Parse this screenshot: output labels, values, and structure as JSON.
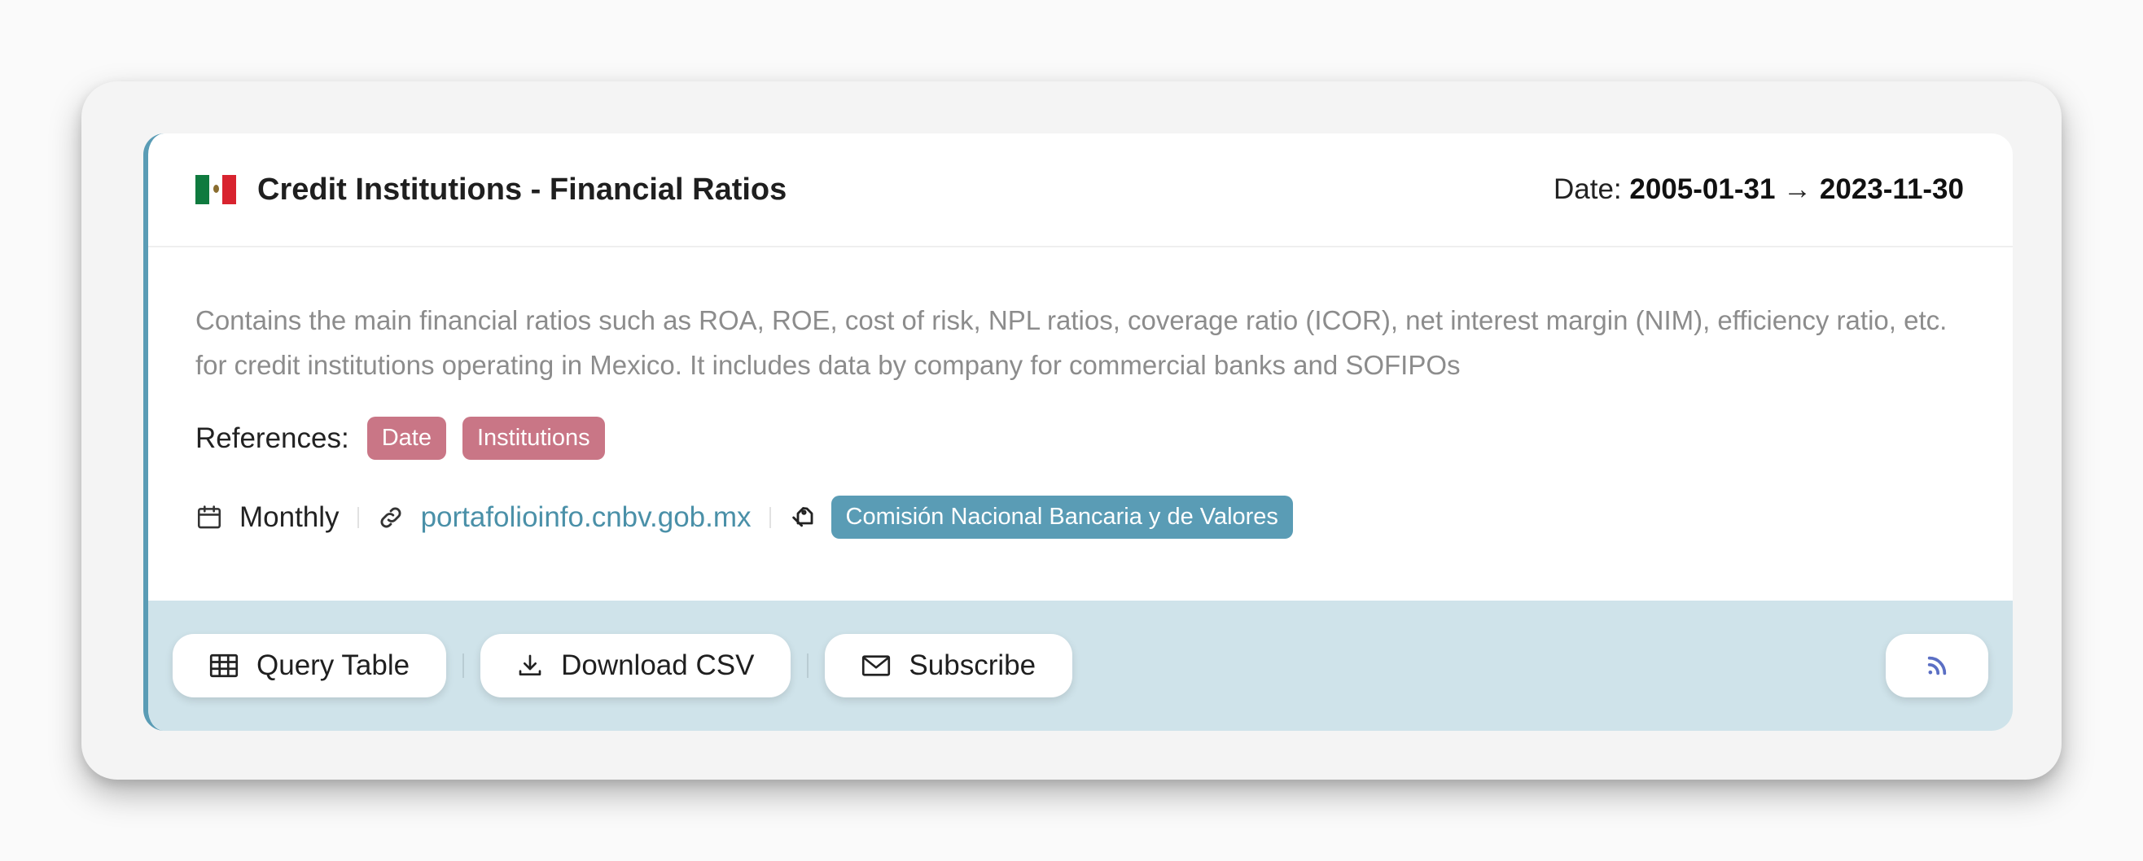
{
  "dataset": {
    "title": "Credit Institutions - Financial Ratios",
    "country_flag": "mexico-flag",
    "date_label": "Date:",
    "date_start": "2005-01-31",
    "date_arrow": "→",
    "date_end": "2023-11-30",
    "description": "Contains the main financial ratios such as ROA, ROE, cost of risk, NPL ratios, coverage ratio (ICOR), net interest margin (NIM), efficiency ratio, etc. for credit institutions operating in Mexico. It includes data by company for commercial banks and SOFIPOs",
    "references_label": "References:",
    "references": [
      "Date",
      "Institutions"
    ],
    "frequency": "Monthly",
    "source_url": "portafolioinfo.cnbv.gob.mx",
    "organization": "Comisión Nacional Bancaria y de Valores"
  },
  "actions": {
    "query_table": "Query Table",
    "download_csv": "Download CSV",
    "subscribe": "Subscribe"
  },
  "colors": {
    "accent": "#5a9cb5",
    "reference_tag": "#c97686",
    "footer_bg": "#cfe3ea",
    "rss_icon": "#5b6fc4"
  }
}
